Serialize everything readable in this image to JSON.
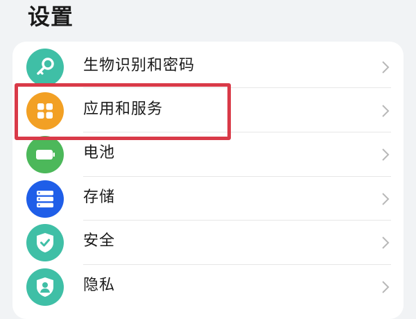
{
  "header": {
    "title": "设置"
  },
  "settings_list": {
    "items": [
      {
        "label": "生物识别和密码",
        "icon": "key-icon",
        "color": "#3fbfa6"
      },
      {
        "label": "应用和服务",
        "icon": "apps-grid-icon",
        "color": "#f2a024"
      },
      {
        "label": "电池",
        "icon": "battery-icon",
        "color": "#4cb85a"
      },
      {
        "label": "存储",
        "icon": "storage-icon",
        "color": "#1f5ee8"
      },
      {
        "label": "安全",
        "icon": "shield-check-icon",
        "color": "#3fbfa6"
      },
      {
        "label": "隐私",
        "icon": "privacy-shield-icon",
        "color": "#3fbfa6"
      }
    ]
  },
  "annotation": {
    "highlight_color": "#d93a48"
  },
  "colors": {
    "background": "#f1f3f5",
    "card": "#ffffff",
    "text": "#1a1a1a",
    "chevron": "#b8b8b8",
    "divider": "#e6e6e6"
  }
}
